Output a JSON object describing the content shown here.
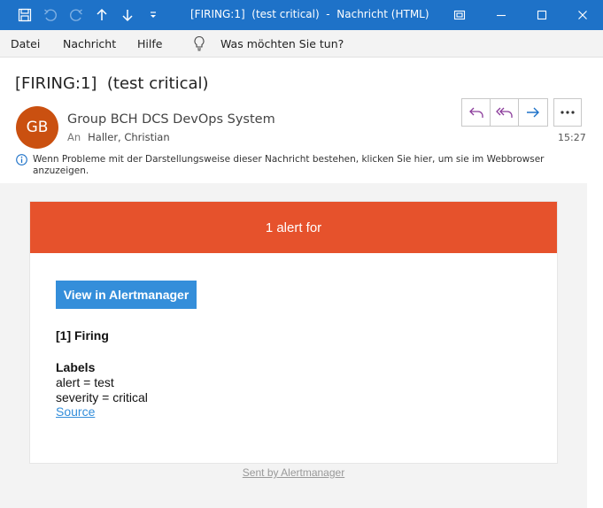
{
  "window": {
    "title": "[FIRING:1]  (test critical)  -  Nachricht (HTML)"
  },
  "menu": {
    "items": [
      "Datei",
      "Nachricht",
      "Hilfe"
    ],
    "tell_me": "Was möchten Sie tun?"
  },
  "message": {
    "subject": "[FIRING:1]  (test critical)",
    "avatar_initials": "GB",
    "avatar_color": "#ca5010",
    "sender": "Group BCH DCS DevOps System",
    "to_label": "An",
    "to": "Haller, Christian",
    "time": "15:27",
    "info": "Wenn Probleme mit der Darstellungsweise dieser Nachricht bestehen, klicken Sie hier, um sie im Webbrowser anzuzeigen."
  },
  "email": {
    "header": "1 alert for",
    "header_color": "#e6522c",
    "button": "View in Alertmanager",
    "button_color": "#348eda",
    "firing": "[1] Firing",
    "labels_title": "Labels",
    "labels": [
      "alert = test",
      "severity = critical"
    ],
    "source_link": "Source",
    "footer": "Sent by Alertmanager"
  },
  "icons": {
    "qat": [
      "save-icon",
      "undo-icon",
      "redo-icon",
      "up-arrow-icon",
      "down-arrow-icon",
      "customize-icon"
    ],
    "window": [
      "restore-icon",
      "minimize-icon",
      "maximize-icon",
      "close-icon"
    ],
    "actions": [
      "reply-icon",
      "reply-all-icon",
      "forward-icon",
      "more-icon"
    ]
  }
}
